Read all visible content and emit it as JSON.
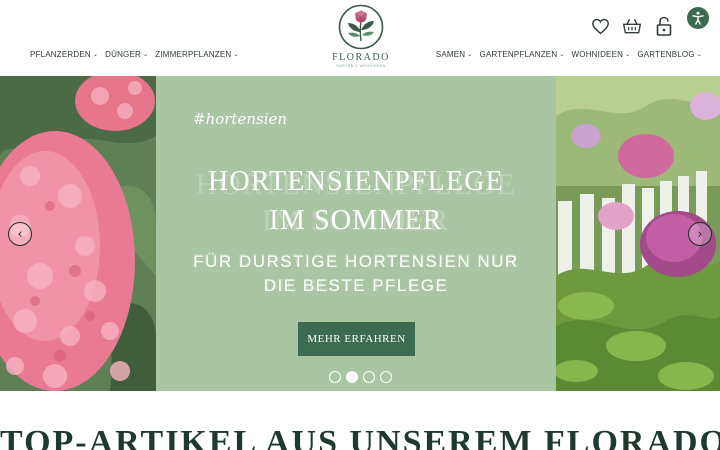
{
  "brand": {
    "name": "FLORADO",
    "tagline": "GARTEN & WOHNIDEEN"
  },
  "nav_left": [
    {
      "label": "PFLANZERDEN"
    },
    {
      "label": "DÜNGER"
    },
    {
      "label": "ZIMMERPFLANZEN"
    }
  ],
  "nav_right": [
    {
      "label": "SAMEN"
    },
    {
      "label": "GARTENPFLANZEN"
    },
    {
      "label": "WOHNIDEEN"
    },
    {
      "label": "GARTENBLOG"
    }
  ],
  "header_icons": [
    "heart-icon",
    "basket-icon",
    "lock-icon"
  ],
  "accessibility_icon": "accessibility-icon",
  "hero": {
    "hashtag": "#hortensien",
    "title_line1": "HORTENSIENPFLEGE",
    "title_line2": "IM SOMMER",
    "subtitle_line1": "FÜR DURSTIGE HORTENSIEN NUR",
    "subtitle_line2": "DIE BESTE PFLEGE",
    "cta_label": "MEHR ERFAHREN",
    "slides": 4,
    "active_slide": 2,
    "prev_label": "‹",
    "next_label": "›"
  },
  "section": {
    "title": "TOP-ARTIKEL AUS UNSEREM FLORADO-"
  },
  "colors": {
    "panel": "#a9c6a2",
    "cta": "#3d6b52",
    "accent": "#3b6a4f",
    "heading": "#1f3a2c"
  }
}
